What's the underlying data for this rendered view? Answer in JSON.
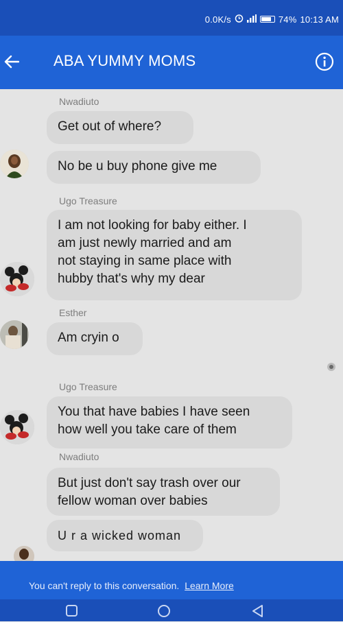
{
  "status_bar": {
    "net_speed": "0.0K/s",
    "battery": "74%",
    "time": "10:13 AM"
  },
  "header": {
    "title": "ABA YUMMY MOMS"
  },
  "messages": [
    {
      "sender": "Nwadiuto",
      "text": "Get out of where?"
    },
    {
      "sender": "",
      "text": "No be u buy phone give me"
    },
    {
      "sender": "Ugo Treasure",
      "lines": [
        "I am not looking for baby either. I",
        "am just newly married and am",
        "not staying in same place with",
        "hubby  that's why my dear"
      ]
    },
    {
      "sender": "Esther",
      "text": "Am cryin o"
    },
    {
      "sender": "Ugo Treasure",
      "lines": [
        "You that have babies I have seen",
        "how well you take care of them"
      ]
    },
    {
      "sender": "Nwadiuto",
      "lines": [
        "But just don't say trash over our",
        "fellow woman over babies"
      ]
    },
    {
      "sender": "",
      "text": "U r a wicked woman"
    }
  ],
  "footer": {
    "notice": "You can't reply to this conversation.",
    "link": "Learn More"
  },
  "colors": {
    "status_bar": "#1a4fb8",
    "app_bar": "#1f63d6",
    "bubble": "#d8d8d8",
    "background": "#e4e4e4"
  },
  "icons": {
    "back": "arrow-left-icon",
    "info": "info-circle-icon",
    "nav_recent": "square-icon",
    "nav_home": "circle-icon",
    "nav_back": "triangle-icon"
  }
}
